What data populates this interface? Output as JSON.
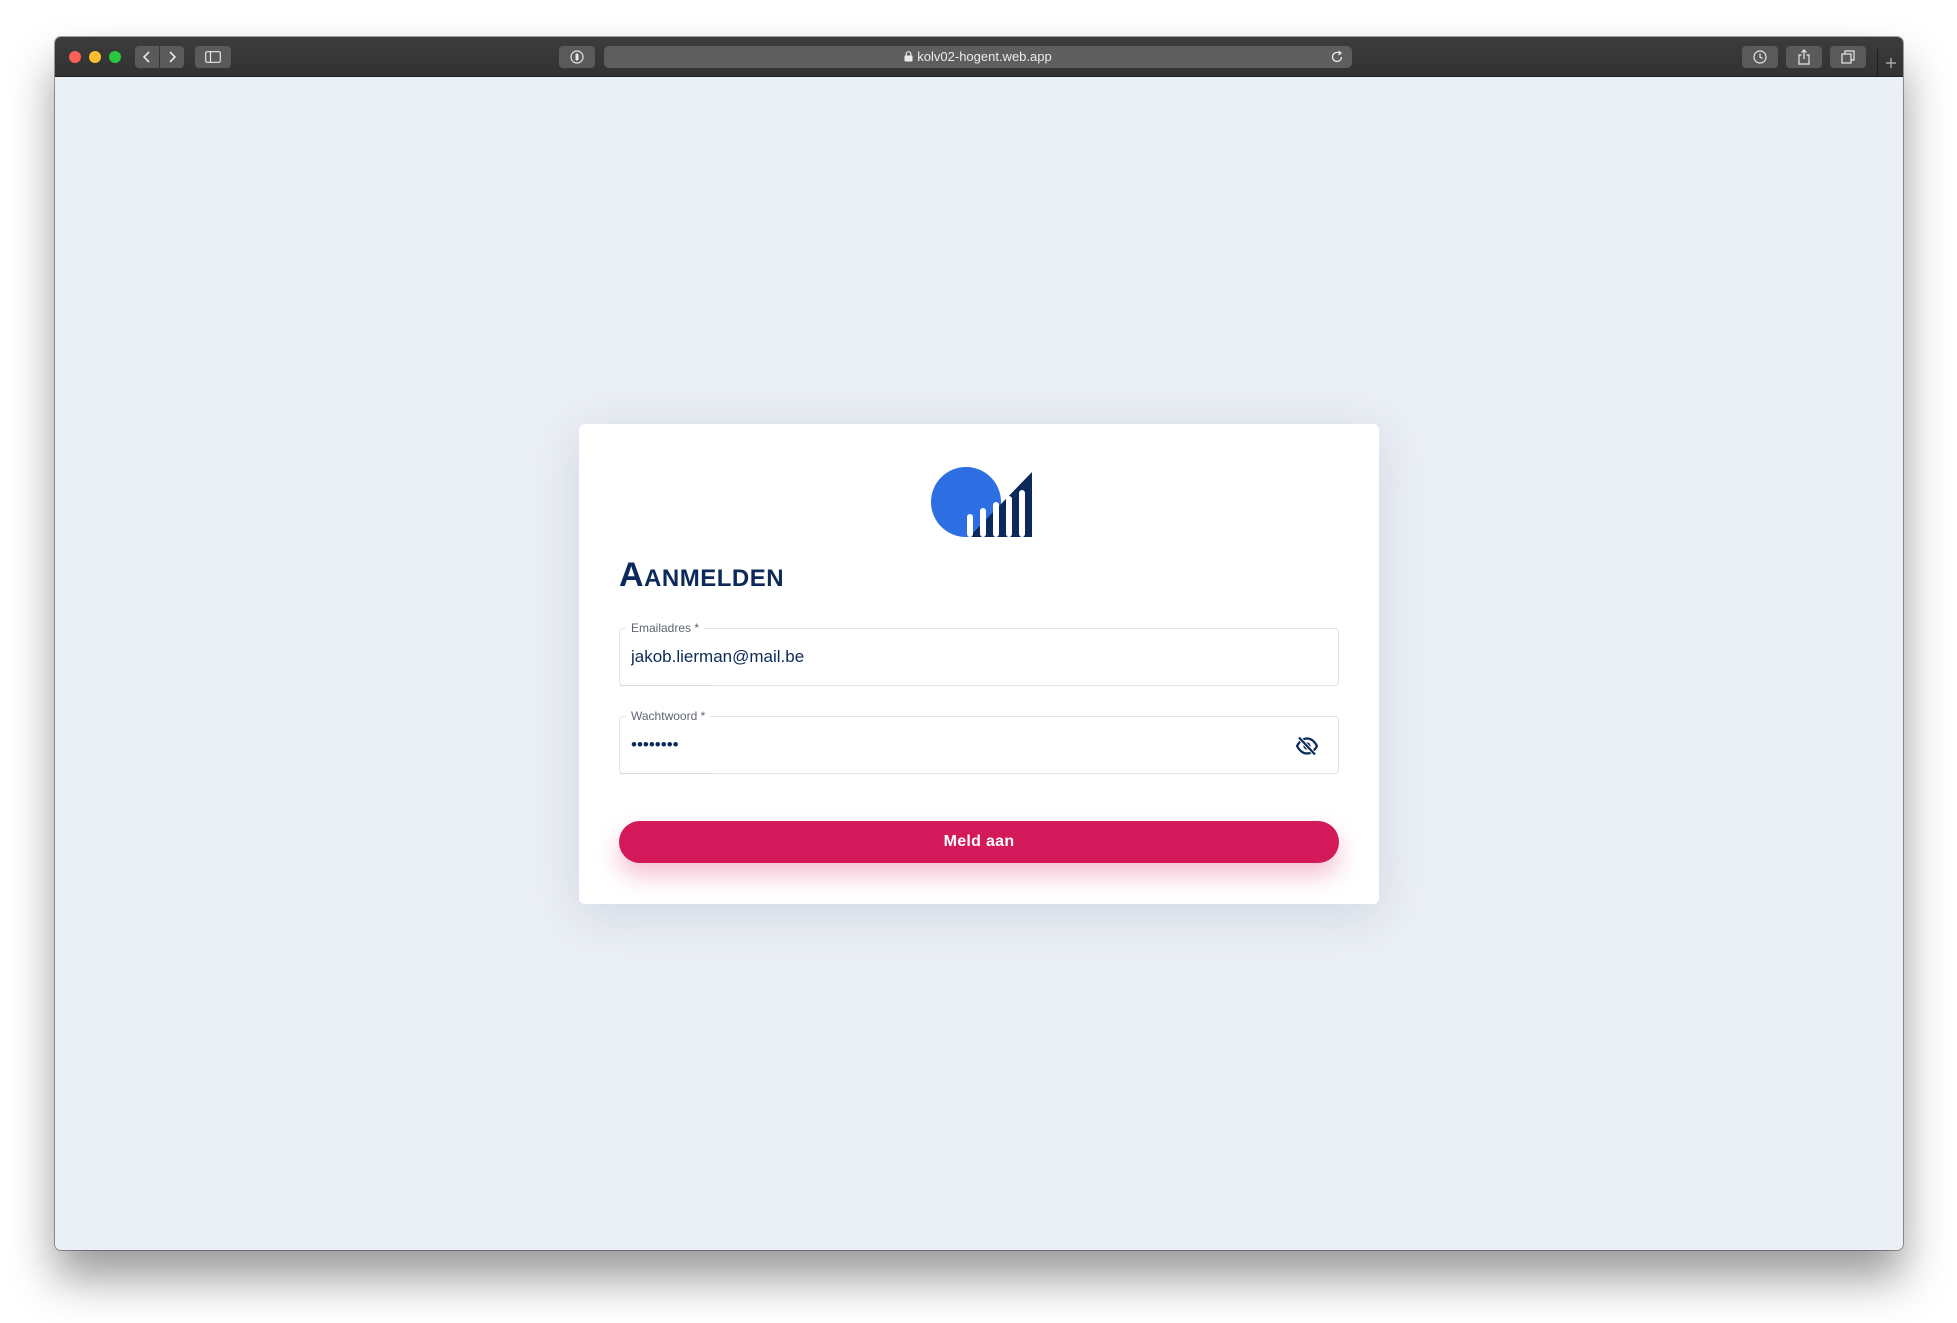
{
  "browser": {
    "url": "kolv02-hogent.web.app"
  },
  "login": {
    "title": "Aanmelden",
    "email_label": "Emailadres *",
    "email_value": "jakob.lierman@mail.be",
    "password_label": "Wachtwoord *",
    "password_value": "••••••••",
    "submit_label": "Meld aan"
  },
  "colors": {
    "primary_dark": "#0b2a5b",
    "logo_blue": "#2d6fe3",
    "accent": "#d3195a",
    "background": "#ebeff6"
  },
  "icons": {
    "password_toggle": "eye-off-icon"
  }
}
